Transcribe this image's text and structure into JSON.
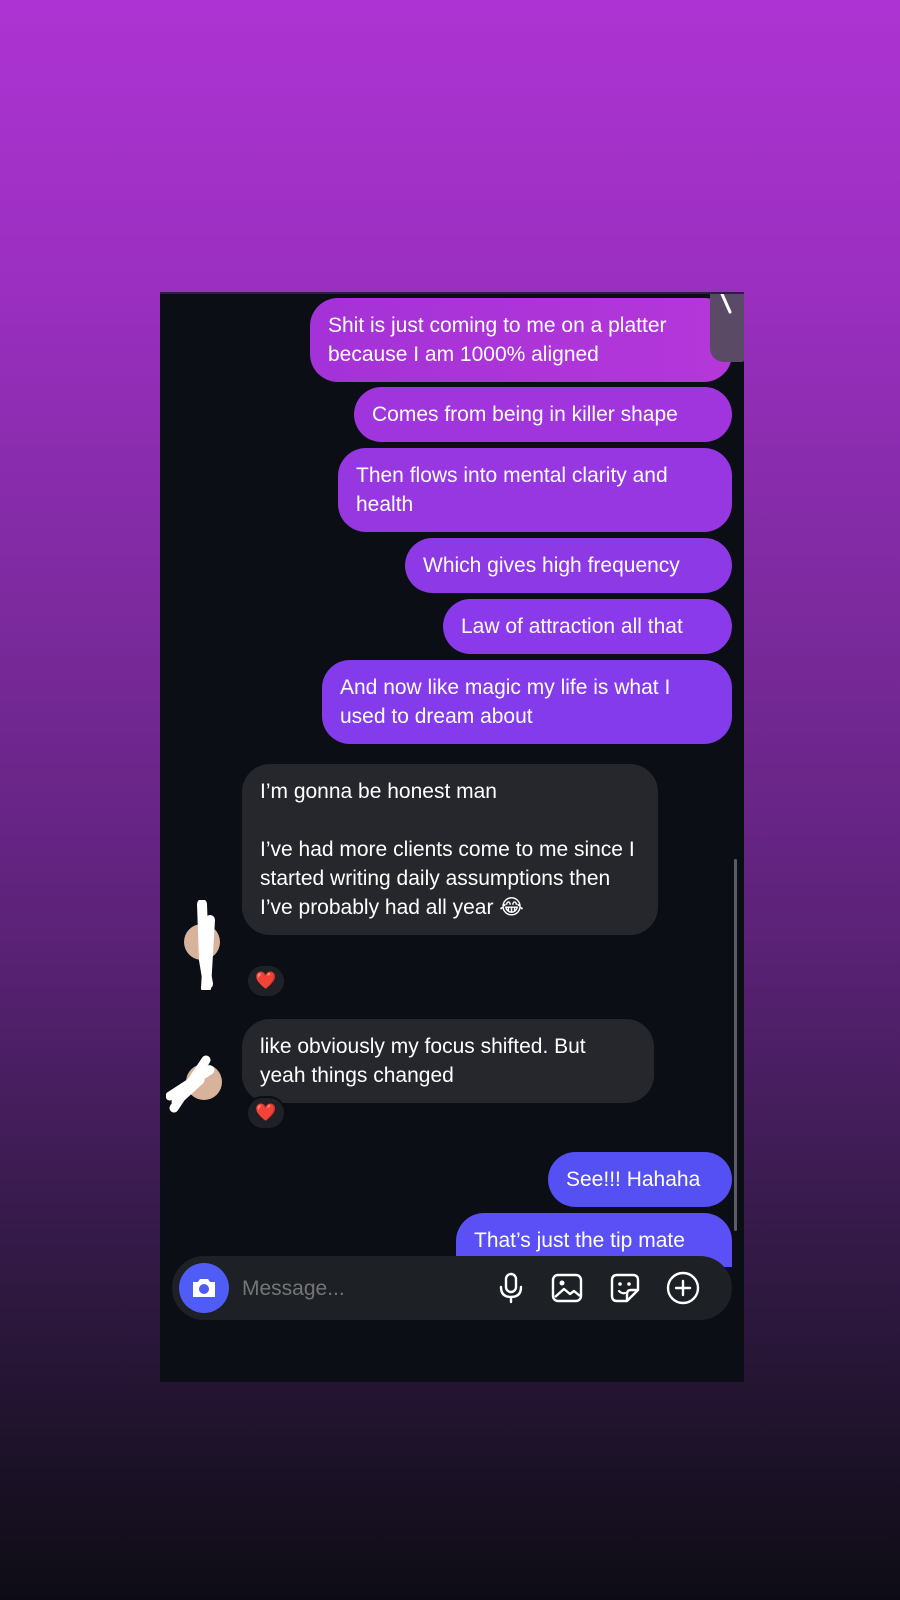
{
  "conversation": {
    "messages": [
      {
        "direction": "outgoing",
        "text": "Shit is just coming to me on a platter because I am 1000% aligned"
      },
      {
        "direction": "outgoing",
        "text": "Comes from being in killer shape"
      },
      {
        "direction": "outgoing",
        "text": "Then flows into mental clarity and health"
      },
      {
        "direction": "outgoing",
        "text": "Which gives high frequency"
      },
      {
        "direction": "outgoing",
        "text": "Law of attraction all that"
      },
      {
        "direction": "outgoing",
        "text": "And now like magic my life is what I used to dream about"
      },
      {
        "direction": "incoming",
        "text": "I’m gonna be honest man\n\nI’ve had more clients come to me since I started writing daily assumptions then I’ve probably had all year 😂",
        "reaction": "❤️"
      },
      {
        "direction": "incoming",
        "text": "like obviously my focus shifted. But yeah things changed",
        "reaction": "❤️"
      },
      {
        "direction": "outgoing",
        "text": "See!!! Hahaha"
      },
      {
        "direction": "outgoing",
        "text": "That’s just the tip mate"
      }
    ]
  },
  "composer": {
    "placeholder": "Message...",
    "icons": [
      "camera-icon",
      "microphone-icon",
      "gallery-icon",
      "sticker-icon",
      "plus-circle-icon"
    ]
  },
  "colors": {
    "background_top": "#ad34d2",
    "background_bottom": "#0d0c14",
    "chat_bg": "#0b0e15",
    "outgoing_top": "#b437d9",
    "outgoing_bottom": "#5b4cf4",
    "incoming": "#25272d",
    "accent": "#4f5cf5"
  }
}
